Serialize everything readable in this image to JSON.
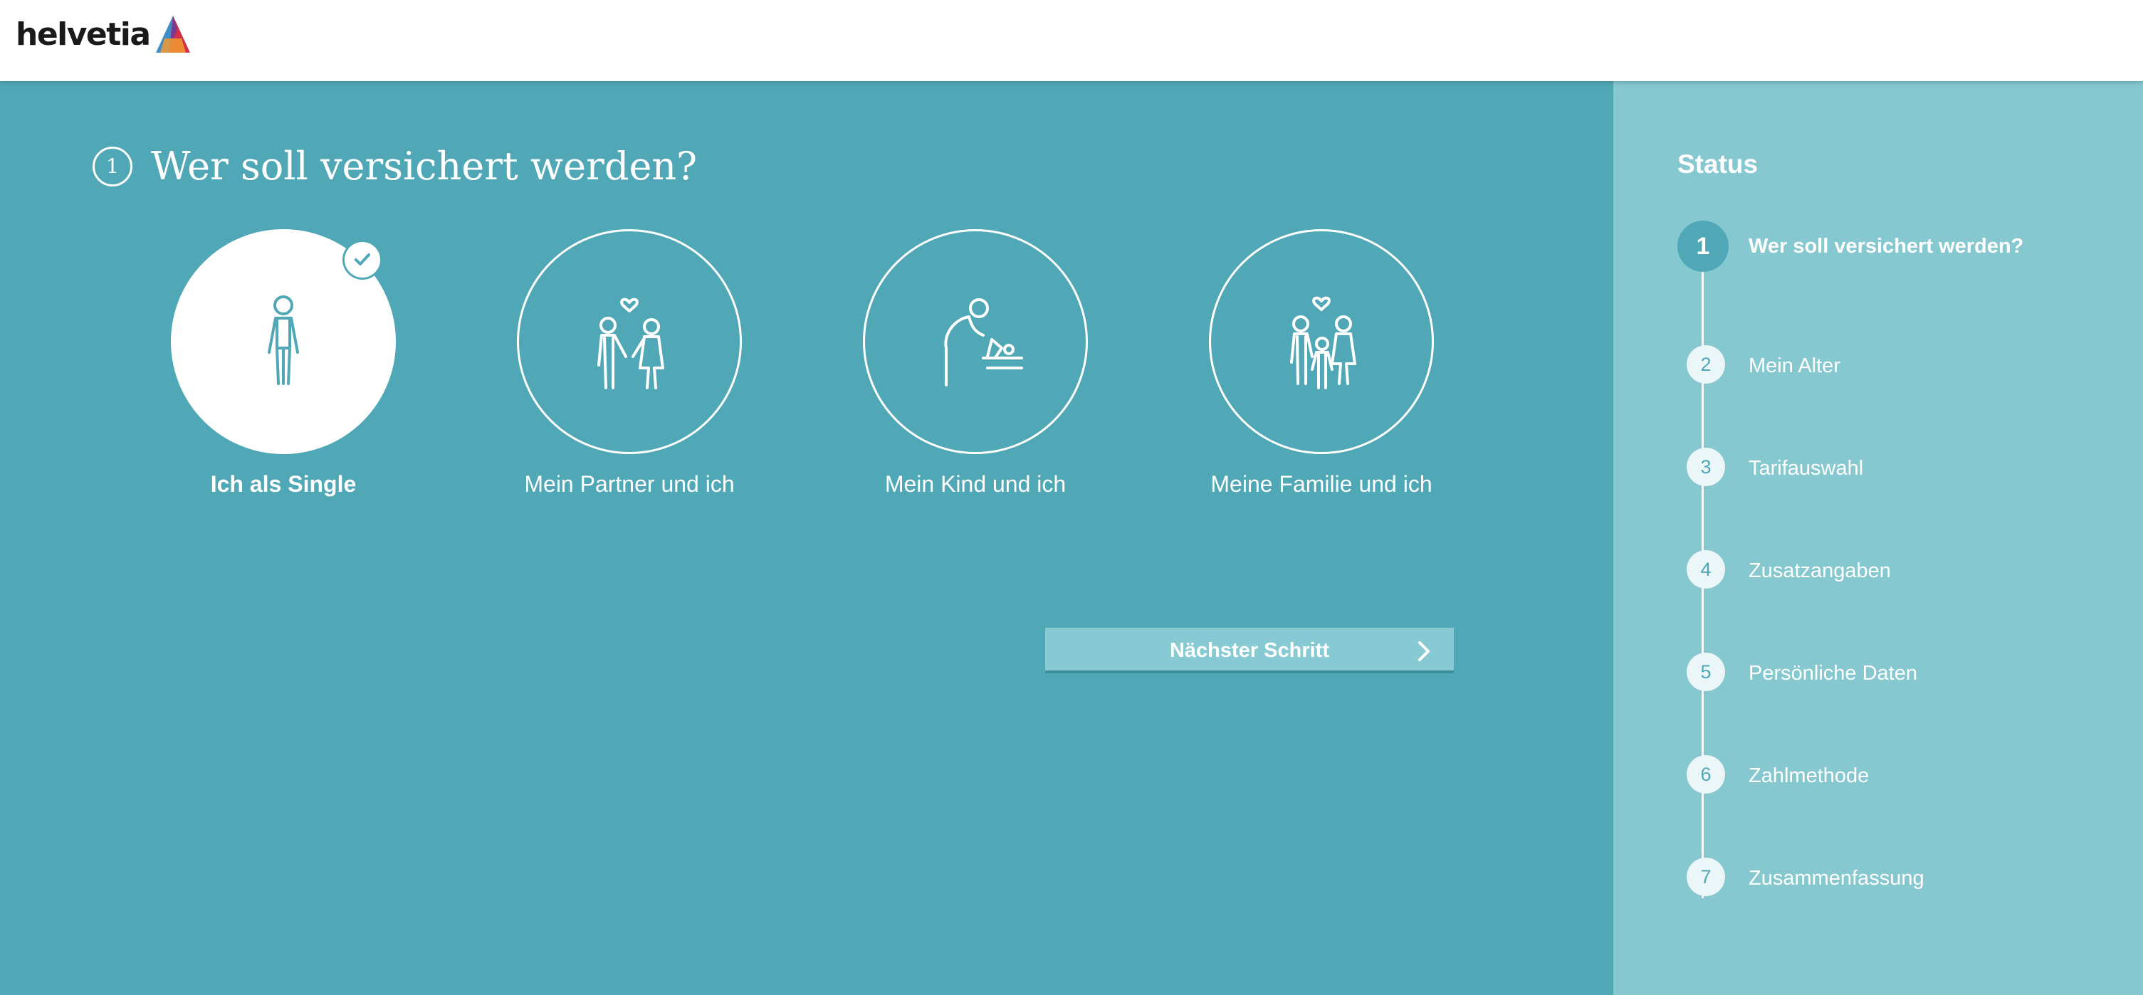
{
  "brand": {
    "name": "helvetia"
  },
  "main": {
    "step_number": "1",
    "title": "Wer soll versichert werden?",
    "options": [
      {
        "label": "Ich als Single",
        "icon": "single-person-icon",
        "selected": true
      },
      {
        "label": "Mein Partner und ich",
        "icon": "couple-icon",
        "selected": false
      },
      {
        "label": "Mein Kind und ich",
        "icon": "parent-child-icon",
        "selected": false
      },
      {
        "label": "Meine Familie und ich",
        "icon": "family-icon",
        "selected": false
      }
    ],
    "next_button": {
      "label": "Nächster Schritt"
    }
  },
  "sidebar": {
    "title": "Status",
    "steps": [
      {
        "number": "1",
        "label": "Wer soll versichert werden?",
        "active": true
      },
      {
        "number": "2",
        "label": "Mein Alter",
        "active": false
      },
      {
        "number": "3",
        "label": "Tarifauswahl",
        "active": false
      },
      {
        "number": "4",
        "label": "Zusatzangaben",
        "active": false
      },
      {
        "number": "5",
        "label": "Persönliche Daten",
        "active": false
      },
      {
        "number": "6",
        "label": "Zahlmethode",
        "active": false
      },
      {
        "number": "7",
        "label": "Zusammenfassung",
        "active": false
      }
    ]
  },
  "colors": {
    "main_bg": "#50a8b6",
    "sidebar_bg": "#86c8d0",
    "button_bg": "#88cad3",
    "header_bg": "#ffffff"
  }
}
